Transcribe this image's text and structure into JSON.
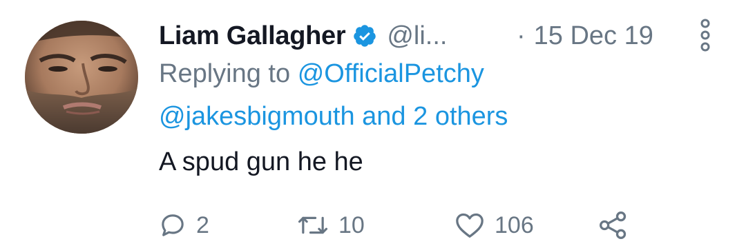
{
  "tweet": {
    "author_name": "Liam Gallagher",
    "handle": "@li...",
    "date_separator": "·",
    "date": "15 Dec 19",
    "replying_prefix": "Replying to",
    "replying_to_first": "@OfficialPetchy",
    "replying_to_rest": "@jakesbigmouth and 2 others",
    "text": "A spud gun he he",
    "verified": true
  },
  "actions": {
    "reply_count": "2",
    "retweet_count": "10",
    "like_count": "106"
  },
  "icons": {
    "verified": "verified-badge-icon",
    "more": "more-options-icon",
    "reply": "reply-bubble-icon",
    "retweet": "retweet-icon",
    "like": "heart-icon",
    "share": "share-icon"
  },
  "colors": {
    "name": "#141823",
    "secondary": "#687684",
    "link": "#1b95e0",
    "verified": "#1b95e0"
  }
}
